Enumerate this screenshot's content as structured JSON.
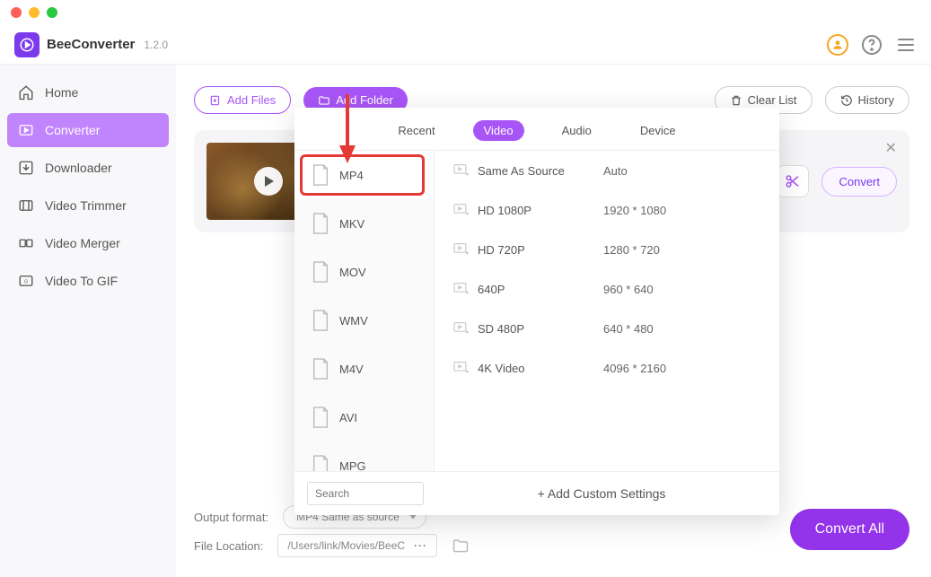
{
  "app": {
    "name": "BeeConverter",
    "version": "1.2.0"
  },
  "sidebar": {
    "items": [
      {
        "label": "Home"
      },
      {
        "label": "Converter"
      },
      {
        "label": "Downloader"
      },
      {
        "label": "Video Trimmer"
      },
      {
        "label": "Video Merger"
      },
      {
        "label": "Video To GIF"
      }
    ]
  },
  "toolbar": {
    "add_files": "Add Files",
    "add_folder": "Add Folder",
    "clear_list": "Clear List",
    "history": "History"
  },
  "file_card": {
    "convert_label": "Convert"
  },
  "popup": {
    "tabs": {
      "recent": "Recent",
      "video": "Video",
      "audio": "Audio",
      "device": "Device"
    },
    "formats": [
      "MP4",
      "MKV",
      "MOV",
      "WMV",
      "M4V",
      "AVI",
      "MPG"
    ],
    "resolutions": [
      {
        "name": "Same As Source",
        "dim": "Auto"
      },
      {
        "name": "HD 1080P",
        "dim": "1920 * 1080"
      },
      {
        "name": "HD 720P",
        "dim": "1280 * 720"
      },
      {
        "name": "640P",
        "dim": "960 * 640"
      },
      {
        "name": "SD 480P",
        "dim": "640 * 480"
      },
      {
        "name": "4K Video",
        "dim": "4096 * 2160"
      }
    ],
    "search_placeholder": "Search",
    "add_custom": "+ Add Custom Settings"
  },
  "bottom": {
    "output_format_label": "Output format:",
    "output_format_value": "MP4 Same as source",
    "file_location_label": "File Location:",
    "file_location_value": "/Users/link/Movies/BeeC"
  },
  "convert_all": "Convert All"
}
